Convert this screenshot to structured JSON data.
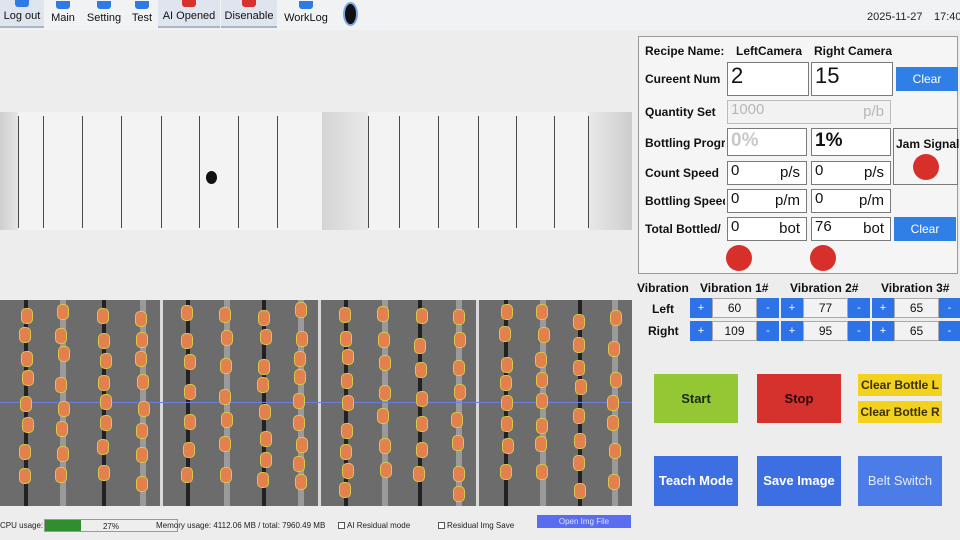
{
  "toolbar": {
    "logout": "Log out",
    "main": "Main",
    "setting": "Setting",
    "test": "Test",
    "ai": "AI Opened",
    "disenable": "Disenable",
    "worklog": "WorkLog",
    "date": "2025-11-27",
    "time": "17:40"
  },
  "recipe": {
    "label": "Recipe Name:",
    "left_camera": "LeftCamera",
    "right_camera": "Right Camera"
  },
  "current_num": {
    "label": "Cureent Num",
    "left": "2",
    "right": "15",
    "clear": "Clear"
  },
  "quantity_set": {
    "label": "Quantity Set",
    "value": "1000",
    "unit": "p/b"
  },
  "bottling_progress": {
    "label": "Bottling Progress",
    "left": "0%",
    "right": "1%"
  },
  "jam_signal": {
    "label": "Jam Signal",
    "color": "#d7302a"
  },
  "count_speed": {
    "label": "Count Speed",
    "left": "0",
    "right": "0",
    "unit": "p/s"
  },
  "bottling_speed": {
    "label": "Bottling Speed",
    "left": "0",
    "right": "0",
    "unit": "p/m"
  },
  "total_bottled": {
    "label": "Total Bottled/",
    "left": "0",
    "right": "76",
    "unit": "bot",
    "clear": "Clear"
  },
  "vibration": {
    "title": "Vibration",
    "headers": [
      "Vibration 1#",
      "Vibration 2#",
      "Vibration 3#"
    ],
    "left_label": "Left",
    "right_label": "Right",
    "plus": "+",
    "minus": "-",
    "left": [
      "60",
      "77",
      "65"
    ],
    "right": [
      "109",
      "95",
      "65"
    ]
  },
  "buttons": {
    "start": "Start",
    "stop": "Stop",
    "clear_bottle_l": "Clear Bottle L",
    "clear_bottle_r": "Clear Bottle R",
    "teach": "Teach Mode",
    "save_image": "Save Image",
    "belt_switch": "Belt Switch"
  },
  "status": {
    "cpu_label": "CPU usage:",
    "cpu_percent": "27%",
    "cpu_fraction": 0.27,
    "memory": "Memory usage: 4112.06 MB / total: 7960.49 MB",
    "ai_residual": "AI Residual mode",
    "residual_img": "Residual Img Save",
    "open_img": "Open Img File"
  },
  "colors": {
    "start": "#93c834",
    "stop": "#d6322d",
    "yellow": "#f2d21f",
    "blue": "#2f7fe7",
    "blue_dark": "#3d6fe3",
    "cpu": "#2f8f2f"
  }
}
